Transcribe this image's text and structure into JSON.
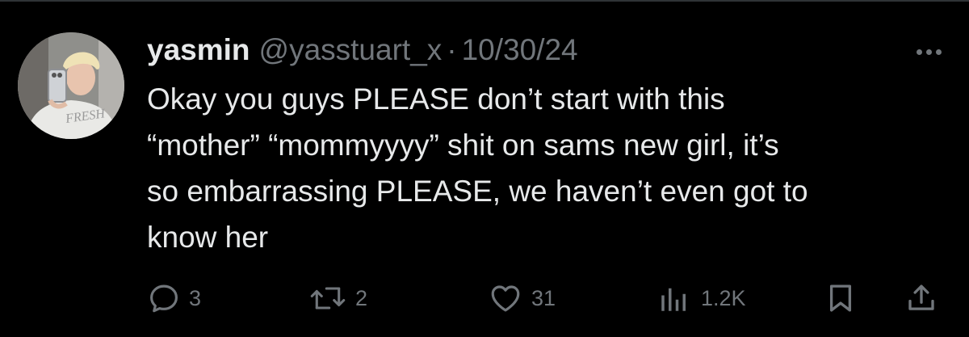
{
  "tweet": {
    "display_name": "yasmin",
    "handle": "@yasstuart_x",
    "separator": "·",
    "date": "10/30/24",
    "lines": [
      "Okay you guys PLEASE don’t start with this",
      "“mother” “mommyyyy” shit on sams new girl, it’s",
      "so embarrassing PLEASE, we haven’t even got to",
      "know her"
    ],
    "avatar_shirt_text": "FRESH"
  },
  "actions": {
    "reply_icon": "reply-icon",
    "reply_count": "3",
    "retweet_icon": "retweet-icon",
    "retweet_count": "2",
    "like_icon": "heart-icon",
    "like_count": "31",
    "views_icon": "views-bar-chart-icon",
    "views_count": "1.2K",
    "bookmark_icon": "bookmark-icon",
    "share_icon": "share-icon",
    "more_icon": "more-options-icon"
  },
  "colors": {
    "background": "#000000",
    "primary_text": "#e7e9ea",
    "secondary_text": "#71767b",
    "divider": "#2f3336"
  }
}
